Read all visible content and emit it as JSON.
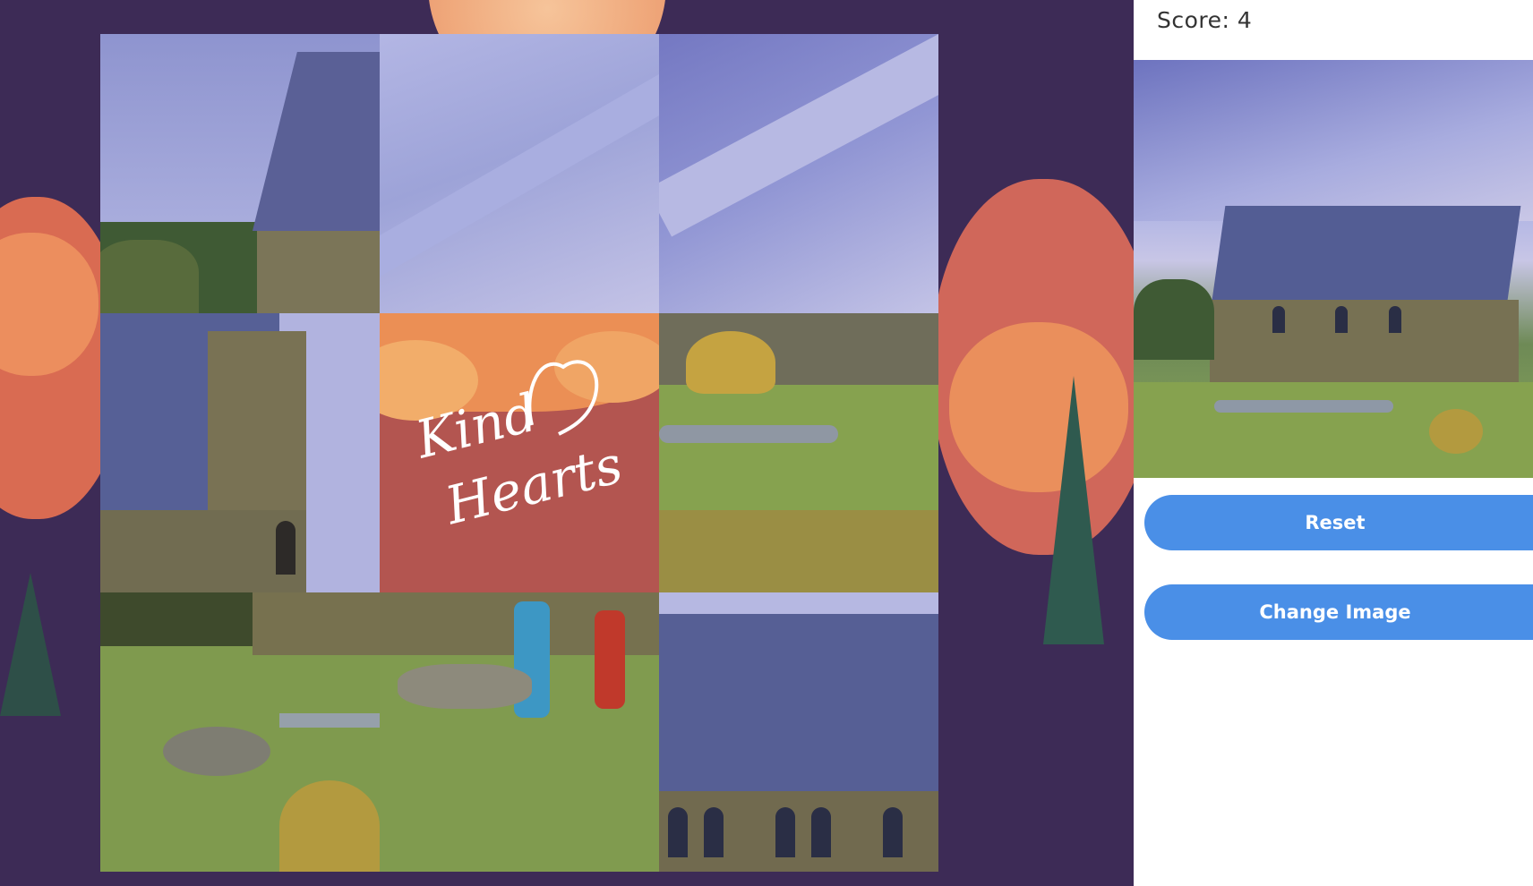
{
  "game": {
    "board": {
      "rows": 3,
      "cols": 3,
      "tiles": [
        {
          "content": "church-roof-left-and-trees"
        },
        {
          "content": "mountain-slope"
        },
        {
          "content": "mountain-slope-upper"
        },
        {
          "content": "church-gable-wall"
        },
        {
          "content": "kind-hearts-logo"
        },
        {
          "content": "stone-wall-and-meadow"
        },
        {
          "content": "rocks-and-grass"
        },
        {
          "content": "visitors-and-grass"
        },
        {
          "content": "church-roof-and-windows"
        }
      ],
      "logo": {
        "line1": "Kind",
        "line2": "Hearts"
      }
    }
  },
  "panel": {
    "score_text": "Score: 4",
    "reset_label": "Reset",
    "change_image_label": "Change Image"
  },
  "colors": {
    "stage_bg": "#3d2b56",
    "button": "#4a8fe7",
    "logo_tile": "#b35550",
    "slate_roof": "#565f95",
    "stone": "#7a7458",
    "grass": "#7f9a4e"
  }
}
